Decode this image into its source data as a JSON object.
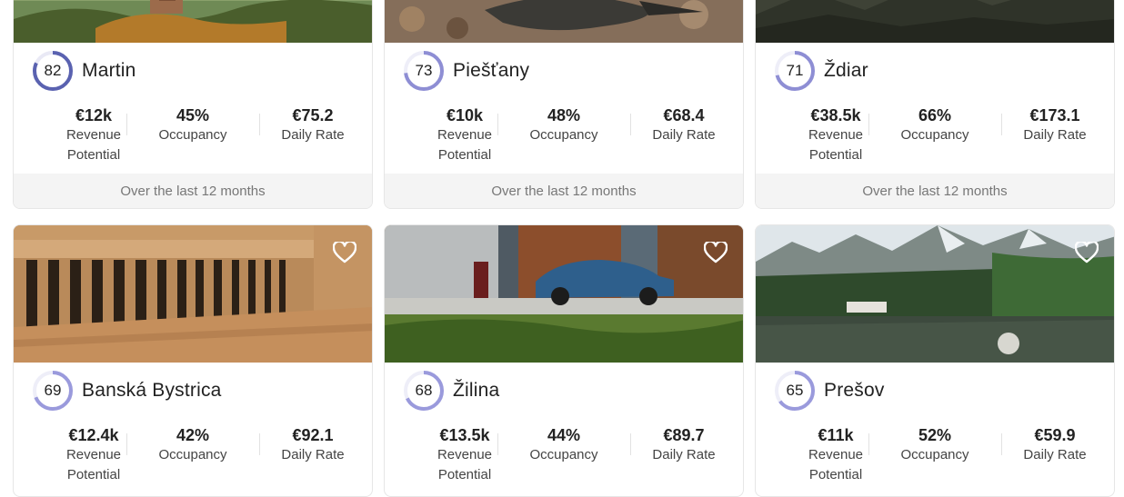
{
  "cards": [
    {
      "score": "82",
      "city": "Martin",
      "revenue": "€12k",
      "revenue_label": "Revenue Potential",
      "occupancy": "45%",
      "occupancy_label": "Occupancy",
      "daily_rate": "€75.2",
      "daily_rate_label": "Daily Rate",
      "footer": "Over the last 12 months",
      "ring_color": "#5a62b0",
      "score_fraction": 0.82
    },
    {
      "score": "73",
      "city": "Piešťany",
      "revenue": "€10k",
      "revenue_label": "Revenue Potential",
      "occupancy": "48%",
      "occupancy_label": "Occupancy",
      "daily_rate": "€68.4",
      "daily_rate_label": "Daily Rate",
      "footer": "Over the last 12 months",
      "ring_color": "#8e8ed4",
      "score_fraction": 0.73
    },
    {
      "score": "71",
      "city": "Ždiar",
      "revenue": "€38.5k",
      "revenue_label": "Revenue Potential",
      "occupancy": "66%",
      "occupancy_label": "Occupancy",
      "daily_rate": "€173.1",
      "daily_rate_label": "Daily Rate",
      "footer": "Over the last 12 months",
      "ring_color": "#8e8ed4",
      "score_fraction": 0.71
    },
    {
      "score": "69",
      "city": "Banská Bystrica",
      "revenue": "€12.4k",
      "revenue_label": "Revenue Potential",
      "occupancy": "42%",
      "occupancy_label": "Occupancy",
      "daily_rate": "€92.1",
      "daily_rate_label": "Daily Rate",
      "ring_color": "#9a9adc",
      "score_fraction": 0.69
    },
    {
      "score": "68",
      "city": "Žilina",
      "revenue": "€13.5k",
      "revenue_label": "Revenue Potential",
      "occupancy": "44%",
      "occupancy_label": "Occupancy",
      "daily_rate": "€89.7",
      "daily_rate_label": "Daily Rate",
      "ring_color": "#9a9adc",
      "score_fraction": 0.68
    },
    {
      "score": "65",
      "city": "Prešov",
      "revenue": "€11k",
      "revenue_label": "Revenue Potential",
      "occupancy": "52%",
      "occupancy_label": "Occupancy",
      "daily_rate": "€59.9",
      "daily_rate_label": "Daily Rate",
      "ring_color": "#9a9adc",
      "score_fraction": 0.65
    }
  ],
  "icons": {
    "favorite": "heart-outline-icon"
  }
}
